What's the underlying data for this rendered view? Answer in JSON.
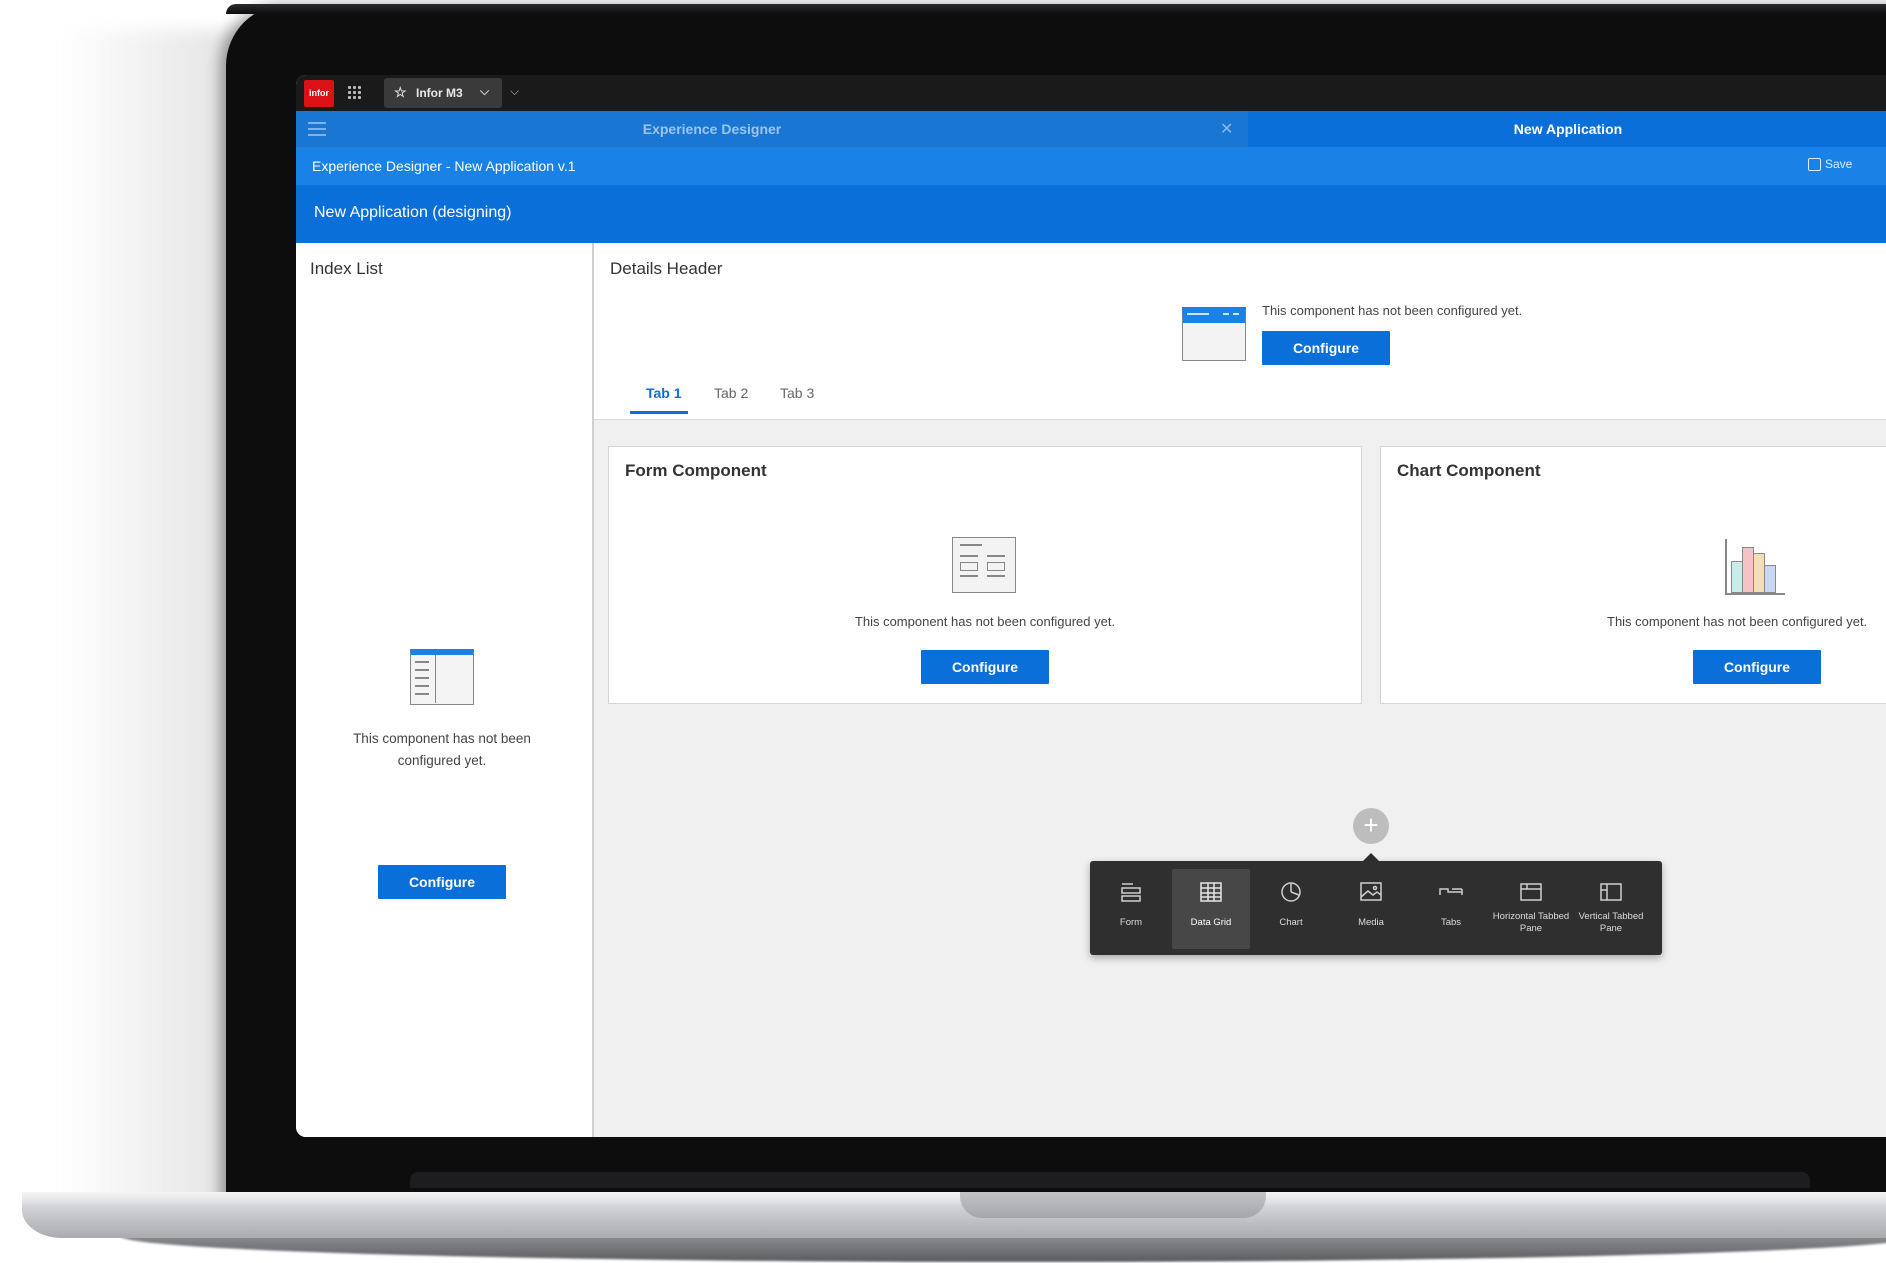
{
  "topbar": {
    "logo_text": "infor",
    "app_name": "Infor M3"
  },
  "tabs": {
    "inactive_label": "Experience Designer",
    "active_label": "New Application"
  },
  "breadcrumb": {
    "text": "Experience Designer - New Application v.1",
    "save_label": "Save"
  },
  "page_title": "New Application (designing)",
  "index_list": {
    "title": "Index List",
    "empty_message": "This component has not been configured yet.",
    "configure_label": "Configure"
  },
  "details": {
    "title": "Details Header",
    "empty_message": "This component has not been configured yet.",
    "configure_label": "Configure",
    "tabs": [
      "Tab 1",
      "Tab 2",
      "Tab 3"
    ],
    "active_tab": "Tab 1"
  },
  "form_component": {
    "title": "Form Component",
    "empty_message": "This component has not been configured yet.",
    "configure_label": "Configure"
  },
  "chart_component": {
    "title": "Chart Component",
    "empty_message": "This component has not been configured yet.",
    "configure_label": "Configure"
  },
  "palette": {
    "add_symbol": "+",
    "items": [
      {
        "label": "Form",
        "icon": "form-icon"
      },
      {
        "label": "Data Grid",
        "icon": "data-grid-icon",
        "selected": true
      },
      {
        "label": "Chart",
        "icon": "chart-icon"
      },
      {
        "label": "Media",
        "icon": "media-icon"
      },
      {
        "label": "Tabs",
        "icon": "tabs-icon"
      },
      {
        "label": "Horizontal Tabbed Pane",
        "icon": "horizontal-tabbed-pane-icon"
      },
      {
        "label": "Vertical Tabbed Pane",
        "icon": "vertical-tabbed-pane-icon"
      }
    ]
  },
  "colors": {
    "brand_red": "#da1217",
    "primary_blue": "#0b6fd9",
    "tabbar_blue": "#1976d2",
    "topbar_dark": "#1a1a1a"
  }
}
